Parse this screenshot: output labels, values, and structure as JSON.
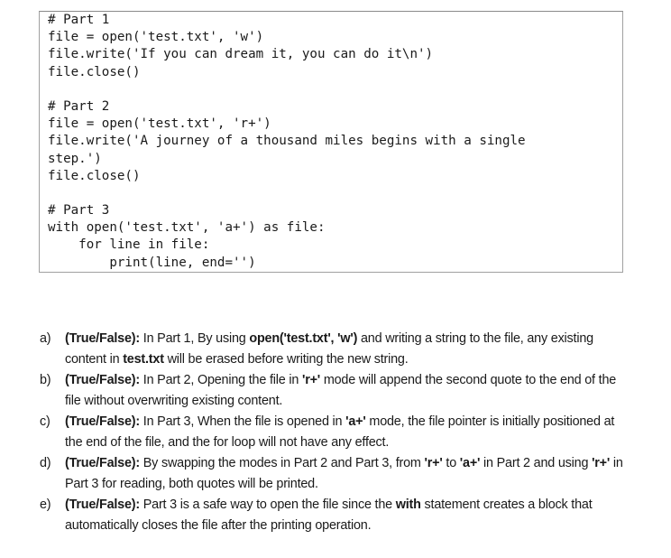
{
  "code": {
    "lines": [
      "# Part 1",
      "file = open('test.txt', 'w')",
      "file.write('If you can dream it, you can do it\\n')",
      "file.close()",
      "",
      "# Part 2",
      "file = open('test.txt', 'r+')",
      "file.write('A journey of a thousand miles begins with a single",
      "step.')",
      "file.close()",
      "",
      "# Part 3",
      "with open('test.txt', 'a+') as file:",
      "    for line in file:",
      "        print(line, end='')"
    ]
  },
  "questions": [
    {
      "letter": "a)",
      "segments": [
        {
          "text": "(True/False):",
          "bold": true
        },
        {
          "text": " In Part 1, By using ",
          "bold": false
        },
        {
          "text": "open('test.txt', 'w')",
          "bold": true
        },
        {
          "text": " and writing a string to the file, any existing content in ",
          "bold": false
        },
        {
          "text": "test.txt",
          "bold": true
        },
        {
          "text": " will be erased before writing the new string.",
          "bold": false
        }
      ]
    },
    {
      "letter": "b)",
      "segments": [
        {
          "text": "(True/False):",
          "bold": true
        },
        {
          "text": " In Part 2, Opening the file in ",
          "bold": false
        },
        {
          "text": "'r+'",
          "bold": true
        },
        {
          "text": " mode will append the second quote to the end of the file without overwriting existing content.",
          "bold": false
        }
      ]
    },
    {
      "letter": "c)",
      "segments": [
        {
          "text": "(True/False):",
          "bold": true
        },
        {
          "text": " In Part 3, When the file is opened in ",
          "bold": false
        },
        {
          "text": "'a+'",
          "bold": true
        },
        {
          "text": " mode, the file pointer is initially positioned at the end of the file, and the for loop will not have any effect.",
          "bold": false
        }
      ]
    },
    {
      "letter": "d)",
      "segments": [
        {
          "text": "(True/False):",
          "bold": true
        },
        {
          "text": " By swapping the modes in Part 2 and Part 3, from ",
          "bold": false
        },
        {
          "text": "'r+'",
          "bold": true
        },
        {
          "text": " to ",
          "bold": false
        },
        {
          "text": "'a+'",
          "bold": true
        },
        {
          "text": " in Part 2 and using ",
          "bold": false
        },
        {
          "text": "'r+'",
          "bold": true
        },
        {
          "text": " in Part 3 for reading, both quotes will be printed.",
          "bold": false
        }
      ]
    },
    {
      "letter": "e)",
      "segments": [
        {
          "text": "(True/False):",
          "bold": true
        },
        {
          "text": " Part 3 is a safe way to open the file since the ",
          "bold": false
        },
        {
          "text": "with",
          "bold": true
        },
        {
          "text": " statement creates a block that automatically closes the file after the printing operation.",
          "bold": false
        }
      ]
    }
  ]
}
